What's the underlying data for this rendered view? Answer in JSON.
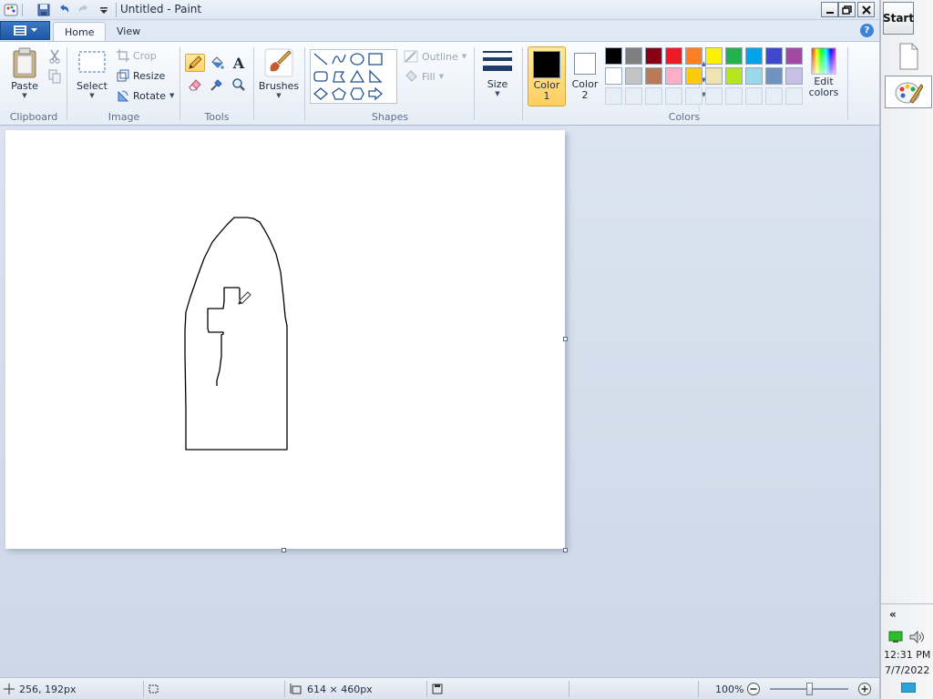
{
  "window": {
    "title": "Untitled - Paint",
    "tabs": {
      "home": "Home",
      "view": "View"
    },
    "help": "?"
  },
  "ribbon": {
    "clipboard": {
      "label": "Clipboard",
      "paste": "Paste"
    },
    "image": {
      "label": "Image",
      "select": "Select",
      "crop": "Crop",
      "resize": "Resize",
      "rotate": "Rotate"
    },
    "tools": {
      "label": "Tools",
      "text_glyph": "A"
    },
    "brushes": {
      "label": "Brushes"
    },
    "shapes": {
      "label": "Shapes",
      "outline": "Outline",
      "fill": "Fill"
    },
    "size": {
      "label": "Size"
    },
    "colors": {
      "label": "Colors",
      "color1_label_line1": "Color",
      "color1_label_line2": "1",
      "color2_label_line1": "Color",
      "color2_label_line2": "2",
      "edit_line1": "Edit",
      "edit_line2": "colors",
      "color1_value": "#000000",
      "color2_value": "#ffffff",
      "palette_row1": [
        "#000000",
        "#7f7f7f",
        "#880015",
        "#ed1c24",
        "#ff7f27",
        "#fff200",
        "#22b14c",
        "#00a2e8",
        "#3f48cc",
        "#a349a4"
      ],
      "palette_row2": [
        "#ffffff",
        "#c3c3c3",
        "#b97a57",
        "#ffaec9",
        "#ffc90e",
        "#efe4b0",
        "#b5e61d",
        "#99d9ea",
        "#7092be",
        "#c8bfe7"
      ],
      "palette_row3": [
        "#e8eef6",
        "#e8eef6",
        "#e8eef6",
        "#e8eef6",
        "#e8eef6",
        "#e8eef6",
        "#e8eef6",
        "#e8eef6",
        "#e8eef6",
        "#e8eef6"
      ]
    }
  },
  "status": {
    "cursor_pos": "256, 192px",
    "canvas_size": "614 × 460px",
    "zoom": "100%",
    "zoom_level": 0.5
  },
  "taskbar": {
    "start": "Start",
    "time": "12:31 PM",
    "date": "7/7/2022",
    "chevron": "«"
  }
}
